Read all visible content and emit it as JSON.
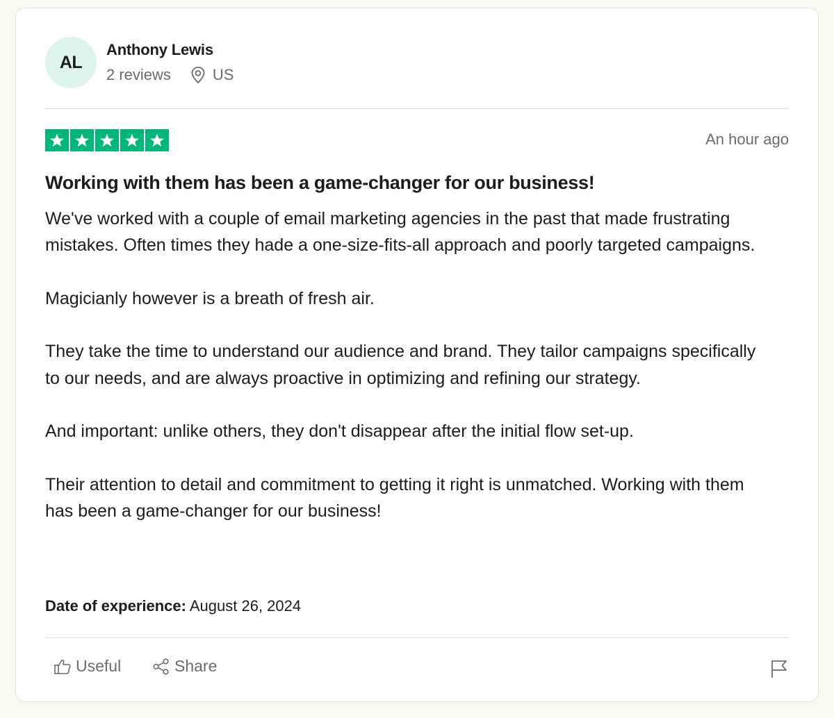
{
  "reviewer": {
    "initials": "AL",
    "name": "Anthony Lewis",
    "review_count": "2 reviews",
    "country": "US"
  },
  "review": {
    "rating": 5,
    "rating_max": 5,
    "star_color": "#00b67a",
    "posted": "An hour ago",
    "title": "Working with them has been a game-changer for our business!",
    "paragraphs": [
      "We've worked with a couple of email marketing agencies in the past that made frustrating mistakes. Often times they hade a one-size-fits-all approach and poorly targeted campaigns.",
      "Magicianly however is a breath of fresh air.",
      "They take the time to understand our audience and brand. They tailor campaigns specifically to our needs, and are always proactive in optimizing and refining our strategy.",
      "And important: unlike others, they don't disappear after the initial flow set-up.",
      "Their attention to detail and commitment to getting it right is unmatched. Working with them has been a game-changer for our business!"
    ],
    "experience_label": "Date of experience:",
    "experience_date": "August 26, 2024"
  },
  "actions": {
    "useful_label": "Useful",
    "share_label": "Share",
    "useful_icon": "thumbs-up-icon",
    "share_icon": "share-icon",
    "flag_icon": "flag-icon"
  },
  "colors": {
    "avatar_bg": "#dcf4ea",
    "muted_text": "#6b6b6b"
  }
}
